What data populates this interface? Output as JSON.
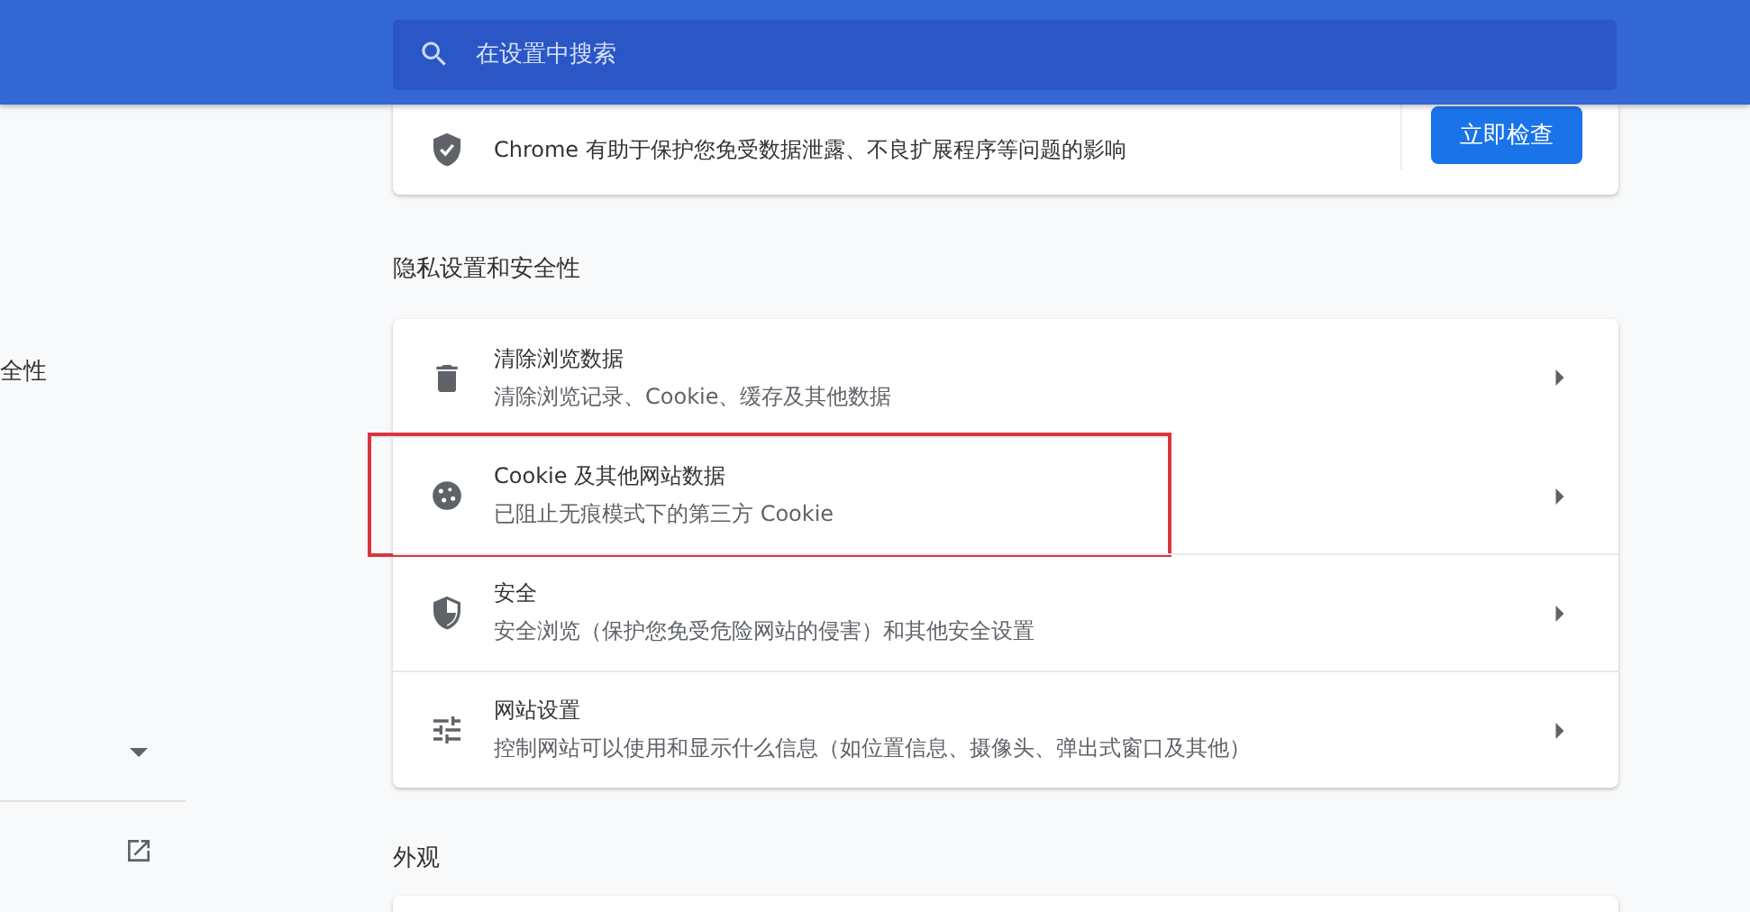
{
  "search": {
    "placeholder": "在设置中搜索"
  },
  "sidebar": {
    "items": [
      {
        "label": "全性"
      }
    ]
  },
  "safety_check": {
    "text": "Chrome 有助于保护您免受数据泄露、不良扩展程序等问题的影响",
    "button": "立即检查"
  },
  "privacy_section": {
    "title": "隐私设置和安全性",
    "rows": [
      {
        "kind": "trash",
        "title": "清除浏览数据",
        "subtitle": "清除浏览记录、Cookie、缓存及其他数据",
        "highlighted": false
      },
      {
        "kind": "cookie",
        "title": "Cookie 及其他网站数据",
        "subtitle": "已阻止无痕模式下的第三方 Cookie",
        "highlighted": true
      },
      {
        "kind": "shield",
        "title": "安全",
        "subtitle": "安全浏览（保护您免受危险网站的侵害）和其他安全设置",
        "highlighted": false
      },
      {
        "kind": "tune",
        "title": "网站设置",
        "subtitle": "控制网站可以使用和显示什么信息（如位置信息、摄像头、弹出式窗口及其他）",
        "highlighted": false
      }
    ]
  },
  "appearance_section": {
    "title": "外观"
  }
}
